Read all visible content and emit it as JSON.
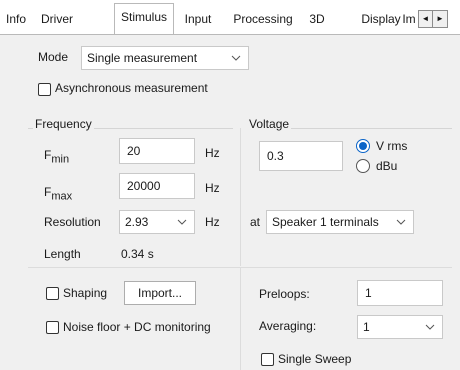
{
  "tabs": [
    {
      "label": "Info",
      "active": false
    },
    {
      "label": "Driver",
      "active": false
    },
    {
      "label": "Stimulus",
      "active": true
    },
    {
      "label": "Input",
      "active": false
    },
    {
      "label": "Processing",
      "active": false
    },
    {
      "label": "3D",
      "active": false
    },
    {
      "label": "Display",
      "active": false
    },
    {
      "label": "Im",
      "active": false
    }
  ],
  "tab_scroll": {
    "left_icon": "scroll-left-icon",
    "right_icon": "scroll-right-icon",
    "left_glyph": "◄",
    "right_glyph": "►"
  },
  "mode": {
    "label": "Mode",
    "value": "Single measurement"
  },
  "async": {
    "label": "Asynchronous measurement",
    "checked": false
  },
  "frequency": {
    "group_label": "Frequency",
    "fmin": {
      "label": "F",
      "sub": "min",
      "value": "20",
      "unit": "Hz"
    },
    "fmax": {
      "label": "F",
      "sub": "max",
      "value": "20000",
      "unit": "Hz"
    },
    "resolution": {
      "label": "Resolution",
      "value": "2.93",
      "unit": "Hz"
    },
    "length": {
      "label": "Length",
      "value": "0.34 s"
    }
  },
  "voltage": {
    "group_label": "Voltage",
    "value": "0.3",
    "options": [
      {
        "label": "V rms",
        "selected": true
      },
      {
        "label": "dBu",
        "selected": false
      }
    ],
    "at_label": "at",
    "terminals": "Speaker 1 terminals"
  },
  "shaping": {
    "label": "Shaping",
    "checked": false,
    "import_label": "Import..."
  },
  "noise_floor": {
    "label": "Noise floor + DC  monitoring",
    "checked": false
  },
  "preloops": {
    "label": "Preloops:",
    "value": "1"
  },
  "averaging": {
    "label": "Averaging:",
    "value": "1"
  },
  "single_sweep": {
    "label": "Single Sweep",
    "checked": false
  },
  "colors": {
    "accent": "#0a64c8",
    "panel": "#f0f0f0",
    "border": "#c9c9c9"
  }
}
